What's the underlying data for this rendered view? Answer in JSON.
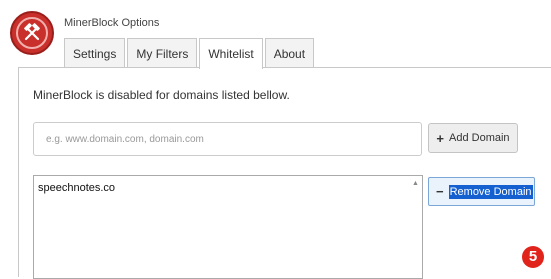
{
  "app": {
    "title": "MinerBlock Options",
    "logo_icon": "crossed-hammers-icon",
    "brand_color": "#c9302c"
  },
  "tabs": [
    {
      "label": "Settings",
      "active": false
    },
    {
      "label": "My Filters",
      "active": false
    },
    {
      "label": "Whitelist",
      "active": true
    },
    {
      "label": "About",
      "active": false
    }
  ],
  "whitelist": {
    "description": "MinerBlock is disabled for domains listed bellow.",
    "input": {
      "placeholder": "e.g. www.domain.com, domain.com",
      "value": ""
    },
    "add_button_label": "Add Domain",
    "add_icon": "plus-icon",
    "domains": [
      "speechnotes.co"
    ],
    "remove_button_label": "Remove Domain",
    "remove_icon": "minus-icon"
  },
  "annotation": {
    "step_number": "5",
    "color": "#e0241b"
  }
}
